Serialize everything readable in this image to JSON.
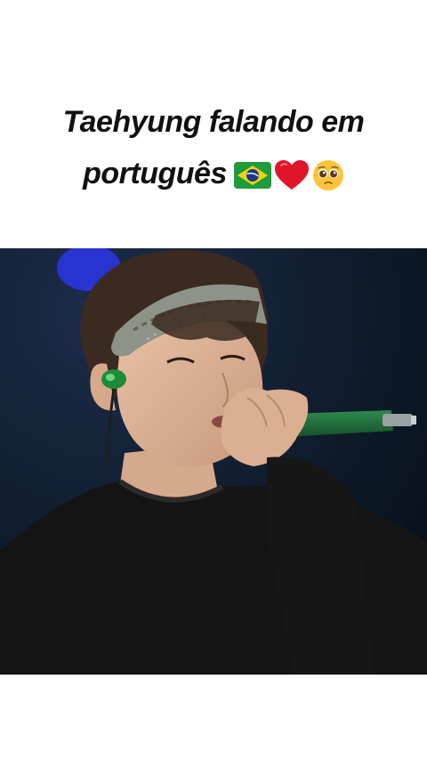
{
  "post": {
    "caption_line1": "Taehyung falando em",
    "caption_line2": "português",
    "caption_emojis": [
      "brazil-flag-icon",
      "red-heart-icon",
      "pleading-face-icon"
    ]
  },
  "media": {
    "type": "video-frame",
    "accent_colors": {
      "background": "#0d1a26",
      "stage_light": "#2a35d8",
      "microphone": "#1f6b3a",
      "shirt": "#141414"
    }
  }
}
